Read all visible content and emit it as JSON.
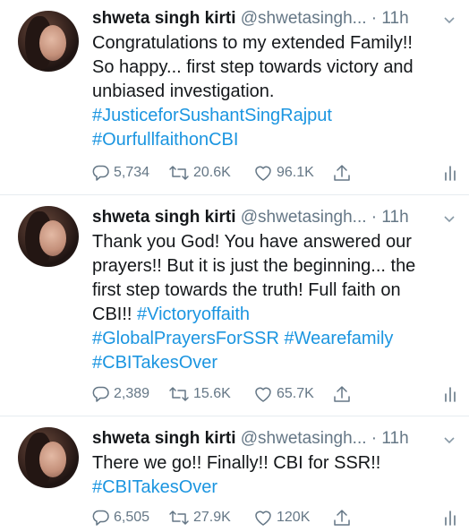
{
  "tweets": [
    {
      "display_name": "shweta singh kirti",
      "handle": "@shwetasingh...",
      "time": "· 11h",
      "lines": [
        [
          {
            "t": "Congratulations to my extended Family!!"
          }
        ],
        [
          {
            "t": "So happy... first step towards victory and"
          }
        ],
        [
          {
            "t": "unbiased investigation."
          }
        ],
        [
          {
            "t": "#JusticeforSushantSingRajput",
            "tag": true
          }
        ],
        [
          {
            "t": "#OurfullfaithonCBI",
            "tag": true
          }
        ]
      ],
      "replies": "5,734",
      "retweets": "20.6K",
      "likes": "96.1K"
    },
    {
      "display_name": "shweta singh kirti",
      "handle": "@shwetasingh...",
      "time": "· 11h",
      "lines": [
        [
          {
            "t": "Thank you God!  You have answered our"
          }
        ],
        [
          {
            "t": "prayers!! But it is just the beginning... the"
          }
        ],
        [
          {
            "t": "first step towards the truth! Full faith on"
          }
        ],
        [
          {
            "t": "CBI!! "
          },
          {
            "t": "#Victoryoffaith",
            "tag": true
          }
        ],
        [
          {
            "t": "#GlobalPrayersForSSR #Wearefamily",
            "tag": true
          }
        ],
        [
          {
            "t": "#CBITakesOver",
            "tag": true
          }
        ]
      ],
      "replies": "2,389",
      "retweets": "15.6K",
      "likes": "65.7K"
    },
    {
      "display_name": "shweta singh kirti",
      "handle": "@shwetasingh...",
      "time": "· 11h",
      "lines": [
        [
          {
            "t": "There we go!! Finally!! CBI for SSR!!"
          }
        ],
        [
          {
            "t": "#CBITakesOver",
            "tag": true
          }
        ]
      ],
      "replies": "6,505",
      "retweets": "27.9K",
      "likes": "120K"
    }
  ],
  "icons": {
    "reply": "reply-icon",
    "retweet": "retweet-icon",
    "like": "heart-icon",
    "share": "share-icon",
    "analytics": "analytics-icon",
    "caret": "chevron-down-icon"
  },
  "colors": {
    "text": "#14171a",
    "muted": "#657786",
    "link": "#1b95e0",
    "divider": "#e6ecf0"
  }
}
